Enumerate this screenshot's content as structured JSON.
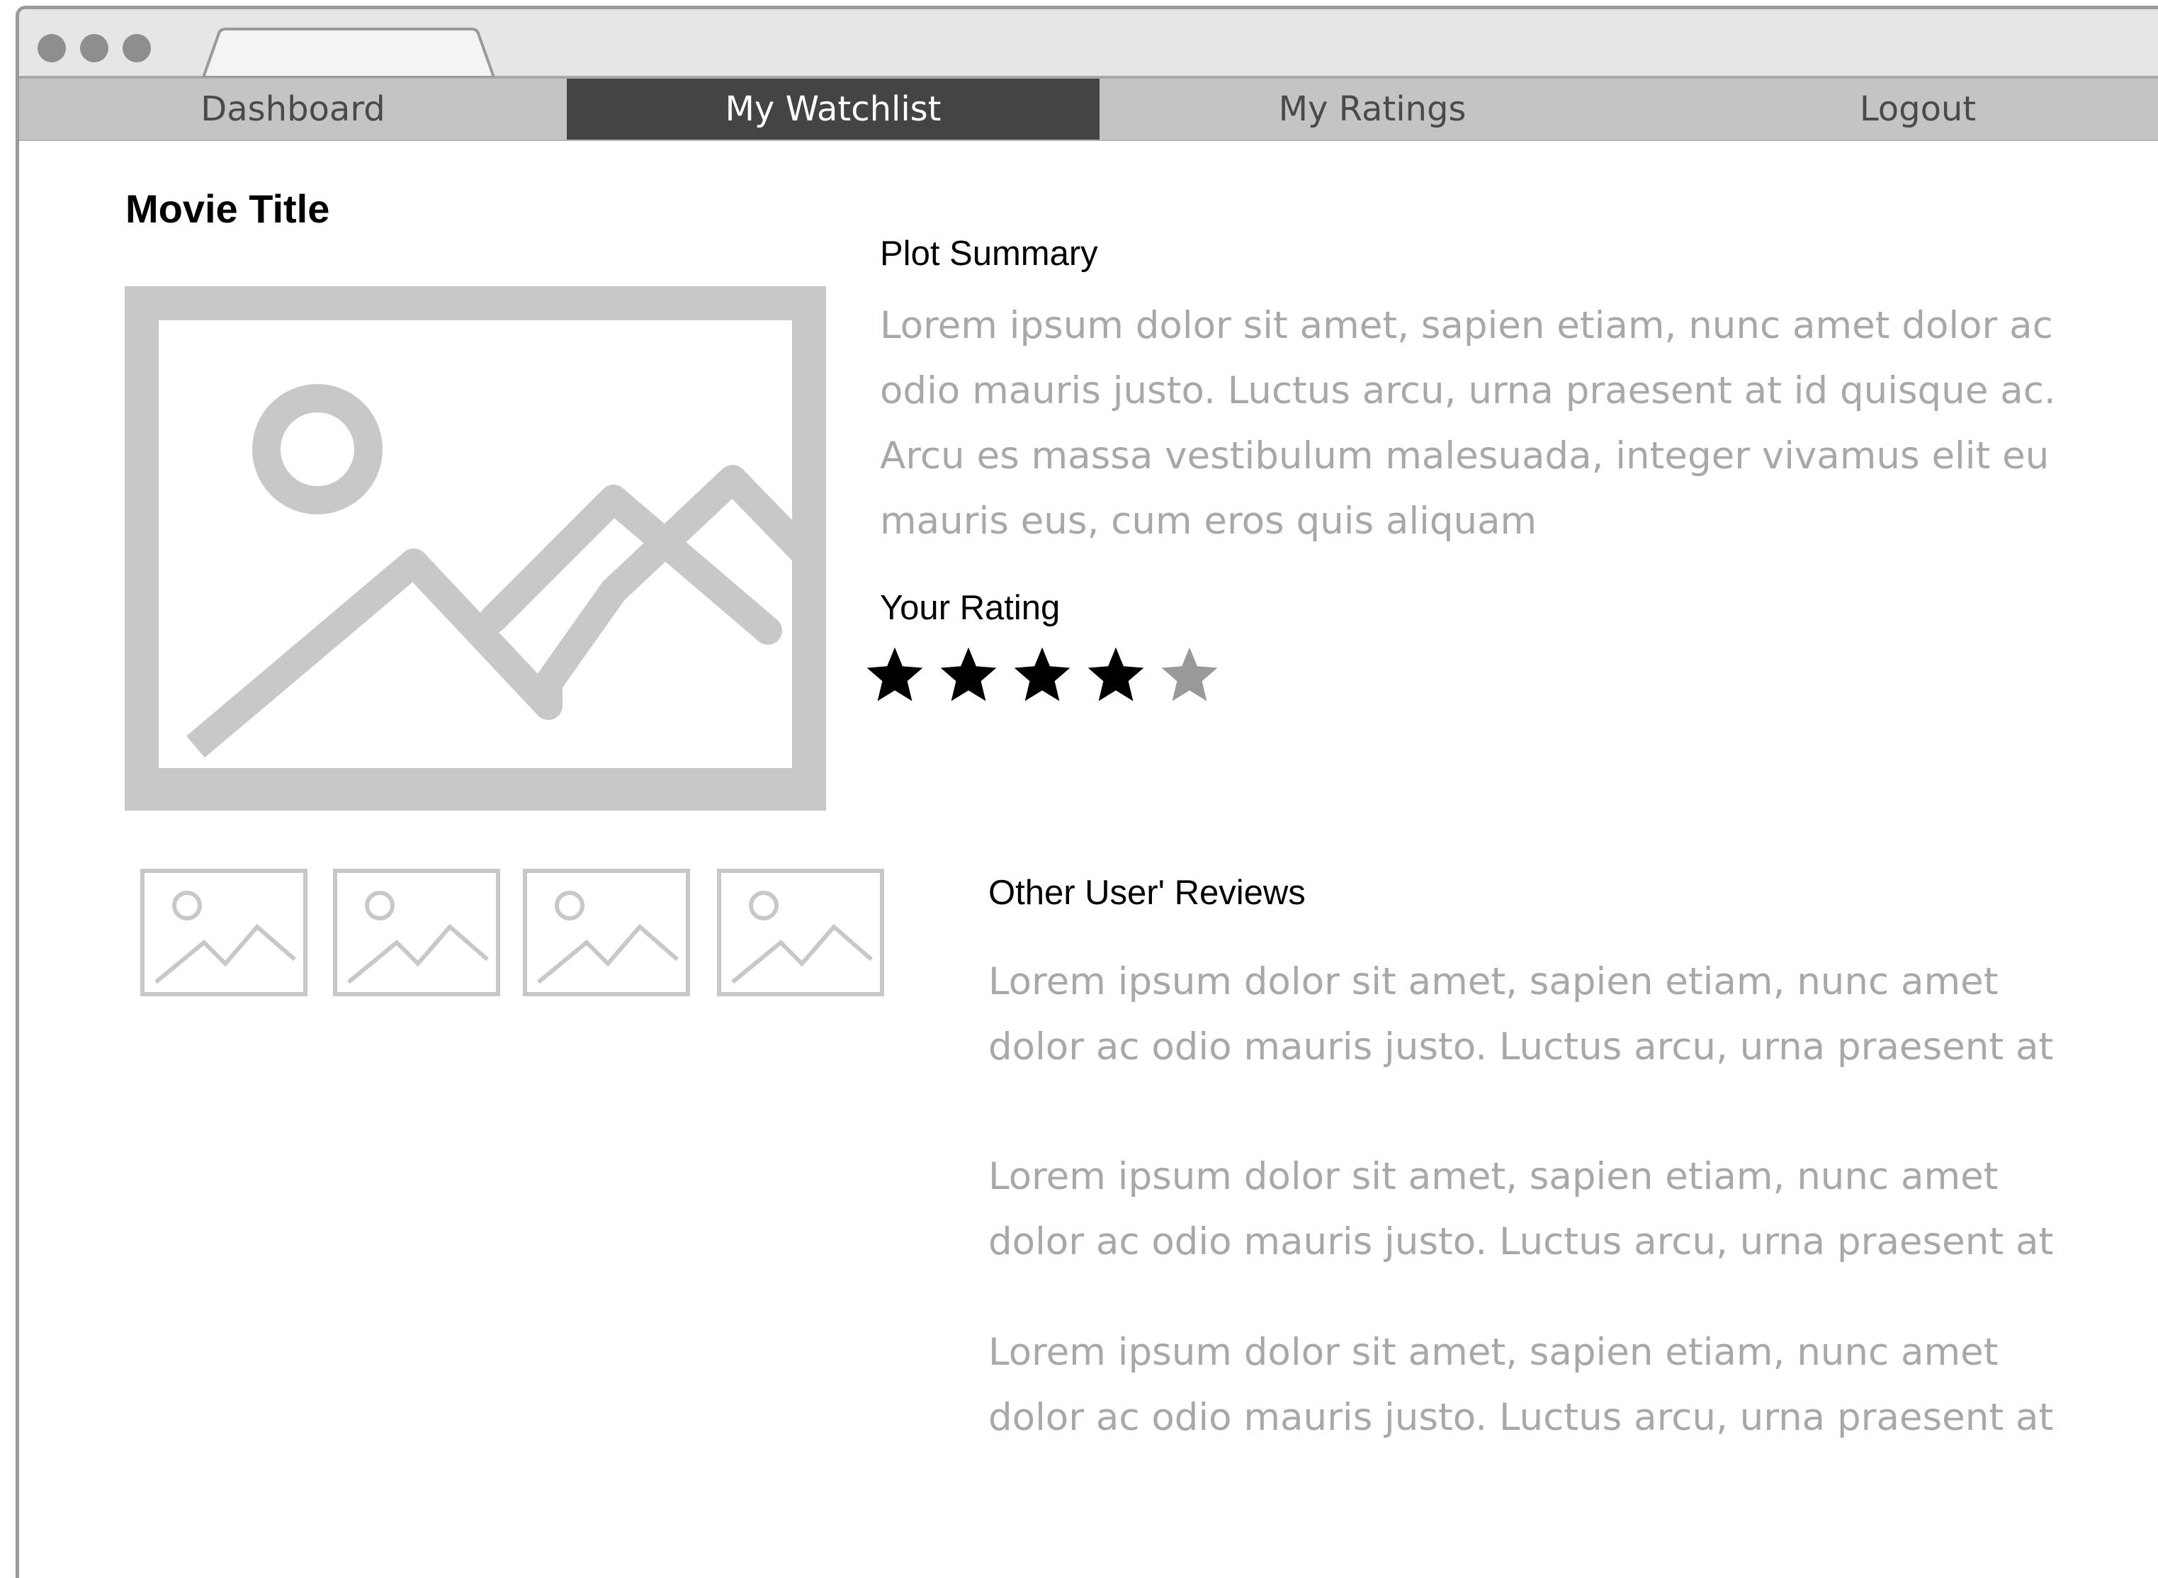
{
  "nav": {
    "items": [
      {
        "label": "Dashboard",
        "active": false
      },
      {
        "label": "My Watchlist",
        "active": true
      },
      {
        "label": "My Ratings",
        "active": false
      },
      {
        "label": "Logout",
        "active": false
      }
    ]
  },
  "movie": {
    "title": "Movie Title",
    "plot_heading": "Plot Summary",
    "plot_lines": [
      "Lorem ipsum dolor sit amet, sapien etiam, nunc amet dolor ac",
      "odio mauris justo. Luctus arcu, urna praesent at id quisque ac.",
      "Arcu es massa vestibulum malesuada, integer vivamus elit eu",
      "mauris eus, cum eros quis aliquam"
    ],
    "rating_heading": "Your Rating",
    "rating": {
      "value": 4,
      "max": 5
    }
  },
  "reviews": {
    "heading": "Other User' Reviews",
    "items": [
      {
        "lines": [
          "Lorem ipsum dolor sit amet, sapien etiam, nunc amet",
          "dolor ac odio mauris justo. Luctus arcu, urna praesent at"
        ]
      },
      {
        "lines": [
          "Lorem ipsum dolor sit amet, sapien etiam, nunc amet",
          "dolor ac odio mauris justo. Luctus arcu, urna praesent at"
        ]
      },
      {
        "lines": [
          "Lorem ipsum dolor sit amet, sapien etiam, nunc amet",
          "dolor ac odio mauris justo. Luctus arcu, urna praesent at"
        ]
      }
    ]
  },
  "icons": {
    "poster": "image-placeholder-icon",
    "thumbnail": "image-placeholder-icon",
    "star": "star-icon"
  },
  "colors": {
    "nav_active_bg": "#444444",
    "nav_bg": "#c4c4c4",
    "placeholder_gray": "#c8c8c8",
    "star_filled": "#000000",
    "star_empty": "#999999",
    "lorem_text": "#a8a8a8"
  }
}
